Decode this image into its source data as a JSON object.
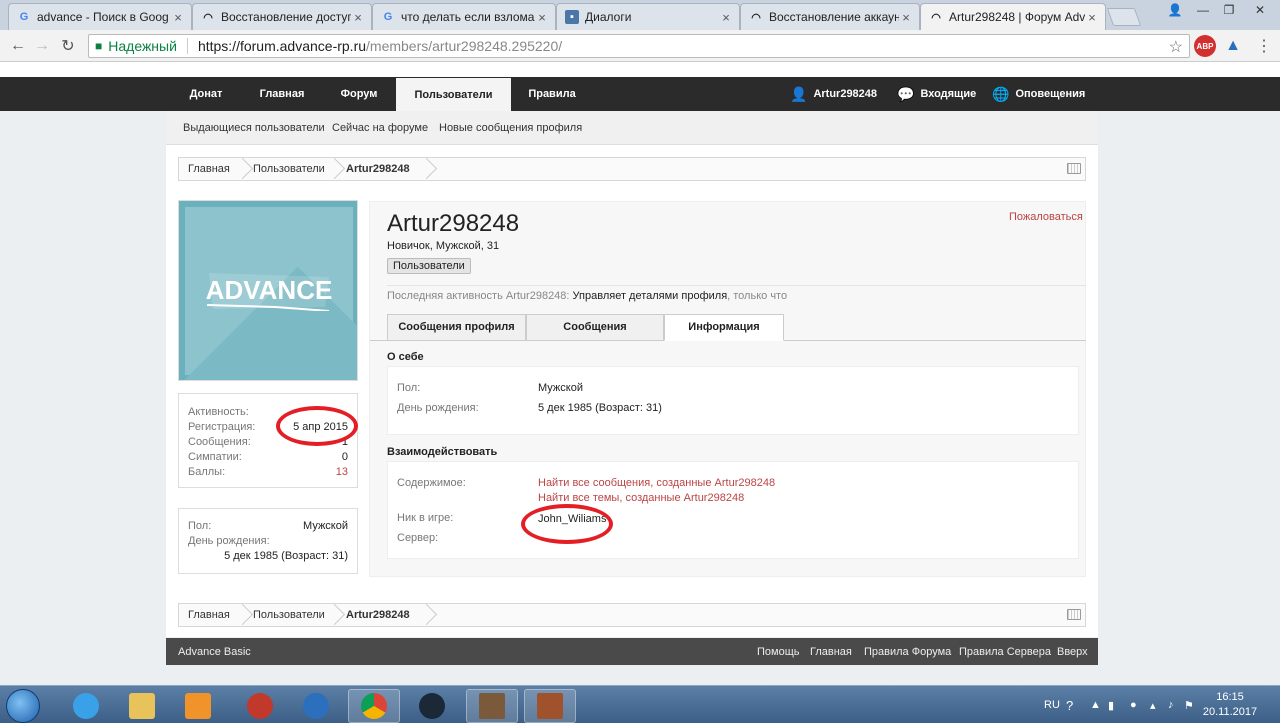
{
  "browser": {
    "tabs": [
      {
        "title": "advance - Поиск в Goog",
        "favicon": "G"
      },
      {
        "title": "Восстановление доступ",
        "favicon": "mask"
      },
      {
        "title": "что делать если взлома",
        "favicon": "G"
      },
      {
        "title": "Диалоги",
        "favicon": "chat"
      },
      {
        "title": "Восстановление аккаун",
        "favicon": "mask"
      },
      {
        "title": "Artur298248 | Форум Adv",
        "favicon": "mask"
      }
    ],
    "secure_label": "Надежный",
    "url_host": "https://forum.advance-rp.ru",
    "url_path": "/members/artur298248.295220/",
    "ext_abp": "ABP"
  },
  "nav": {
    "tabs": [
      "Донат",
      "Главная",
      "Форум",
      "Пользователи",
      "Правила"
    ],
    "user": "Artur298248",
    "inbox": "Входящие",
    "alerts": "Оповещения"
  },
  "subnav": [
    "Выдающиеся пользователи",
    "Сейчас на форуме",
    "Новые сообщения профиля"
  ],
  "breadcrumb": [
    "Главная",
    "Пользователи",
    "Artur298248"
  ],
  "avatar": {
    "logo_text": "ADVANCE"
  },
  "stats": [
    {
      "label": "Активность:",
      "value": ""
    },
    {
      "label": "Регистрация:",
      "value": "5 апр 2015"
    },
    {
      "label": "Сообщения:",
      "value": "1"
    },
    {
      "label": "Симпатии:",
      "value": "0"
    },
    {
      "label": "Баллы:",
      "value": "13"
    }
  ],
  "sideinfo": {
    "gender_label": "Пол:",
    "gender": "Мужской",
    "birthday_label": "День рождения:",
    "birthday": "5 дек 1985 (Возраст: 31)"
  },
  "profile": {
    "username": "Artur298248",
    "title": "Новичок, Мужской, 31",
    "group": "Пользователи",
    "report": "Пожаловаться",
    "last_activity_prefix": "Последняя активность Artur298248: ",
    "last_activity_action": "Управляет деталями профиля",
    "last_activity_time": ", только что",
    "tabs": [
      "Сообщения профиля",
      "Сообщения",
      "Информация"
    ],
    "about_heading": "О себе",
    "about": [
      {
        "label": "Пол:",
        "value": "Мужской"
      },
      {
        "label": "День рождения:",
        "value": "5 дек 1985 (Возраст: 31)"
      }
    ],
    "interact_heading": "Взаимодействовать",
    "content_label": "Содержимое:",
    "find_posts": "Найти все сообщения, созданные Artur298248",
    "find_threads": "Найти все темы, созданные Artur298248",
    "nick_label": "Ник в игре:",
    "nick": "John_Wiliams",
    "server_label": "Сервер:",
    "server": ""
  },
  "footer": {
    "left": "Advance Basic",
    "links": [
      "Помощь",
      "Главная",
      "Правила Форума",
      "Правила Сервера",
      "Вверх"
    ]
  },
  "taskbar": {
    "lang": "RU",
    "time": "16:15",
    "date": "20.11.2017"
  }
}
